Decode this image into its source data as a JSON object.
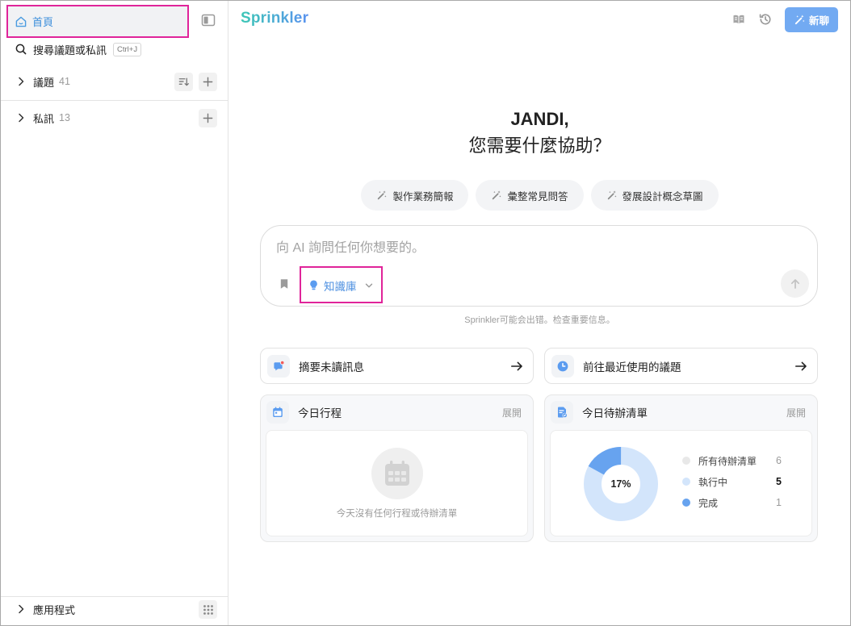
{
  "sidebar": {
    "home": {
      "label": "首頁",
      "icon": "home-icon"
    },
    "search": {
      "label": "搜尋議題或私訊",
      "shortcut": "Ctrl+J",
      "icon": "search-icon"
    },
    "topics": {
      "label": "議題",
      "count": "41"
    },
    "messages": {
      "label": "私訊",
      "count": "13"
    },
    "apps": {
      "label": "應用程式",
      "icon": "grid-icon"
    }
  },
  "header": {
    "title": "Sprinkler",
    "new_chat_label": "新聊"
  },
  "hero": {
    "greeting": "JANDI,",
    "question": "您需要什麼協助？"
  },
  "suggestions": [
    {
      "label": "製作業務簡報",
      "icon": "magic-wand-icon"
    },
    {
      "label": "彙整常見問答",
      "icon": "magic-wand-icon"
    },
    {
      "label": "發展設計概念草圖",
      "icon": "magic-wand-icon"
    }
  ],
  "composer": {
    "placeholder": "向 AI 詢問任何你想要的。",
    "source_label": "知識庫"
  },
  "disclaimer": "Sprinkler可能会出错。检查重要信息。",
  "quick_actions": [
    {
      "label": "摘要未讀訊息",
      "icon": "unread-chat-icon"
    },
    {
      "label": "前往最近使用的議題",
      "icon": "recent-clock-icon"
    }
  ],
  "schedule": {
    "title": "今日行程",
    "expand_label": "展開",
    "empty_text": "今天沒有任何行程或待辦清單"
  },
  "todos": {
    "title": "今日待辦清單",
    "expand_label": "展開",
    "completed_percent_label": "17%",
    "completed_fraction": 0.17,
    "legend": [
      {
        "label": "所有待辦清單",
        "value": "6",
        "color": "#e8e8e8"
      },
      {
        "label": "執行中",
        "value": "5",
        "color": "#d3e5fb"
      },
      {
        "label": "完成",
        "value": "1",
        "color": "#67a3ef"
      }
    ]
  },
  "colors": {
    "accent": "#72aaf2",
    "icon_blue": "#5b9cf0",
    "annotation_outline": "#e0249a",
    "donut_track": "#d3e5fb",
    "donut_done": "#67a3ef"
  }
}
